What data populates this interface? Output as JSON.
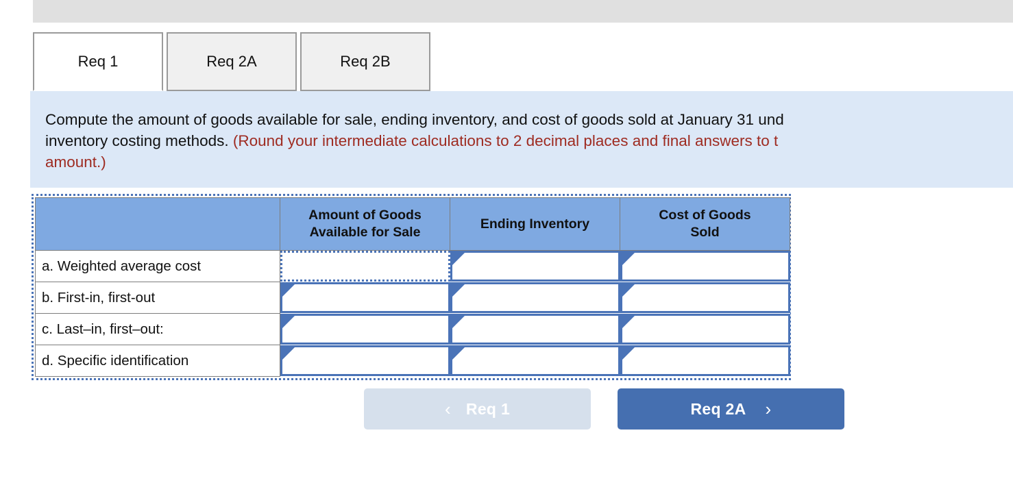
{
  "window": {
    "top_bar_present": true
  },
  "tabs": [
    {
      "label": "Req 1",
      "active": true
    },
    {
      "label": "Req 2A",
      "active": false
    },
    {
      "label": "Req 2B",
      "active": false
    }
  ],
  "instructions": {
    "line1_black": "Compute the amount of goods available for sale, ending inventory, and cost of goods sold at January 31 und",
    "line2_black": "inventory costing methods. ",
    "line2_red": "(Round your intermediate calculations to 2 decimal places and final answers to t",
    "line3_red": "amount.)"
  },
  "table": {
    "headers": [
      "",
      "Amount of Goods Available for Sale",
      "Ending Inventory",
      "Cost of Goods Sold"
    ],
    "header_lines": {
      "col1": [
        "Amount of Goods",
        "Available for Sale"
      ],
      "col2": [
        "Ending Inventory"
      ],
      "col3": [
        "Cost of Goods",
        "Sold"
      ]
    },
    "rows": [
      {
        "label": "a. Weighted average cost",
        "cells": [
          {
            "value": "",
            "selected": true,
            "marker": false
          },
          {
            "value": "",
            "selected": false,
            "marker": true
          },
          {
            "value": "",
            "selected": false,
            "marker": true
          }
        ]
      },
      {
        "label": "b. First-in, first-out",
        "cells": [
          {
            "value": "",
            "selected": false,
            "marker": true
          },
          {
            "value": "",
            "selected": false,
            "marker": true
          },
          {
            "value": "",
            "selected": false,
            "marker": true
          }
        ]
      },
      {
        "label": "c. Last–in, first–out:",
        "cells": [
          {
            "value": "",
            "selected": false,
            "marker": true
          },
          {
            "value": "",
            "selected": false,
            "marker": true
          },
          {
            "value": "",
            "selected": false,
            "marker": true
          }
        ]
      },
      {
        "label": "d. Specific identification",
        "cells": [
          {
            "value": "",
            "selected": false,
            "marker": true
          },
          {
            "value": "",
            "selected": false,
            "marker": true
          },
          {
            "value": "",
            "selected": false,
            "marker": true
          }
        ]
      }
    ]
  },
  "nav": {
    "prev_label": "Req 1",
    "prev_chevron": "‹",
    "prev_disabled": true,
    "next_label": "Req 2A",
    "next_chevron": "›"
  },
  "colors": {
    "top_bar": "#e0e0e0",
    "panel_bg": "#dce8f7",
    "instruction_red": "#9e2b21",
    "table_header_blue": "#7fa9e1",
    "input_border_blue": "#4a73b7",
    "tab_inactive": "#f0f0f0",
    "tab_border": "#9a9a9a",
    "btn_next": "#456fb0",
    "btn_prev_disabled": "#d6e0ec"
  }
}
